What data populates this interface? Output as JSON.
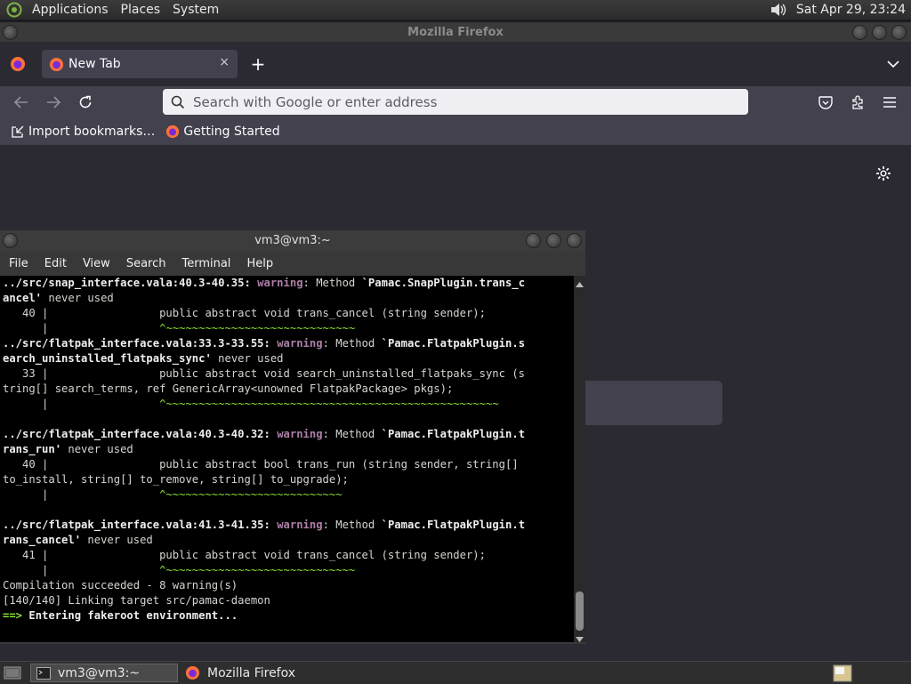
{
  "top_panel": {
    "menus": [
      "Applications",
      "Places",
      "System"
    ],
    "clock": "Sat Apr 29, 23:24"
  },
  "firefox": {
    "window_title": "Mozilla Firefox",
    "tab": {
      "label": "New Tab",
      "close": "×"
    },
    "new_tab": "+",
    "urlbar_placeholder": "Search with Google or enter address",
    "bookmarks": [
      "Import bookmarks…",
      "Getting Started"
    ]
  },
  "terminal": {
    "title": "vm3@vm3:~",
    "menus": [
      "File",
      "Edit",
      "View",
      "Search",
      "Terminal",
      "Help"
    ]
  },
  "taskbar": {
    "tasks": [
      "vm3@vm3:~",
      "Mozilla Firefox"
    ]
  },
  "colors": {
    "firefox_bg": "#2b2a33",
    "warning": "#ad7fa8",
    "tilde": "#8ae234",
    "terminal_bg": "#000000"
  }
}
